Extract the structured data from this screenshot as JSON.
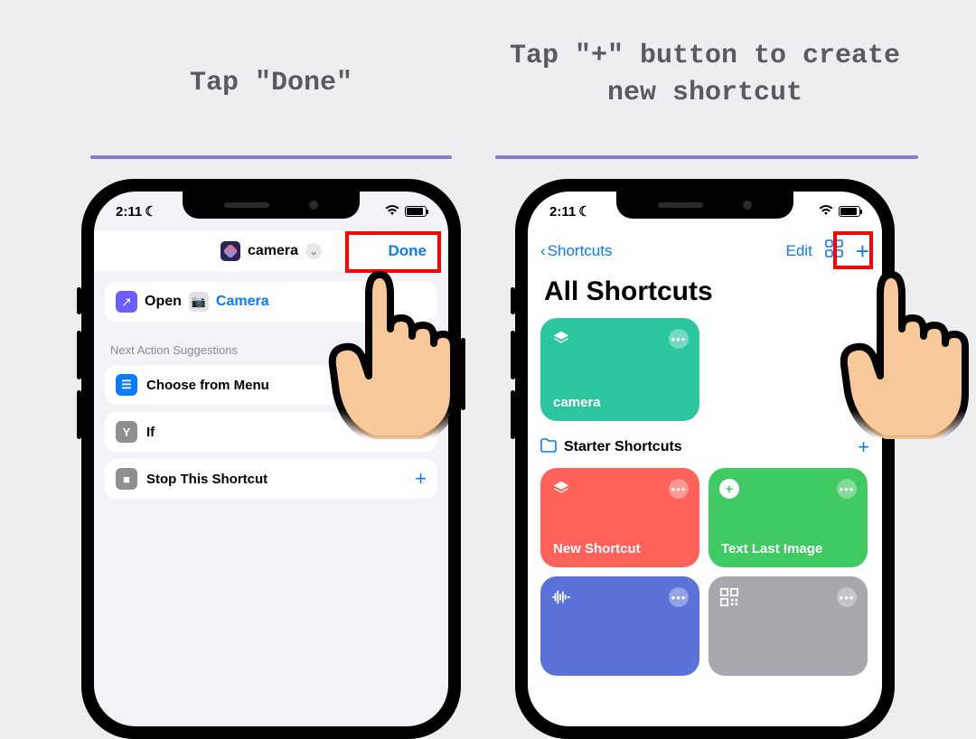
{
  "steps": {
    "step1_title": "Tap \"Done\"",
    "step2_title": "Tap \"+\" button to create new shortcut"
  },
  "status": {
    "time": "2:11",
    "moon": "☾"
  },
  "screen1": {
    "shortcut_name": "camera",
    "done_label": "Done",
    "action": {
      "open_label": "Open",
      "app_name": "Camera"
    },
    "suggestions_header": "Next Action Suggestions",
    "suggestions": [
      {
        "label": "Choose from Menu"
      },
      {
        "label": "If"
      },
      {
        "label": "Stop This Shortcut"
      }
    ]
  },
  "screen2": {
    "back_label": "Shortcuts",
    "edit_label": "Edit",
    "page_title": "All Shortcuts",
    "tile_camera": "camera",
    "section_title": "Starter Shortcuts",
    "tile_new": "New Shortcut",
    "tile_text": "Text Last Image"
  }
}
